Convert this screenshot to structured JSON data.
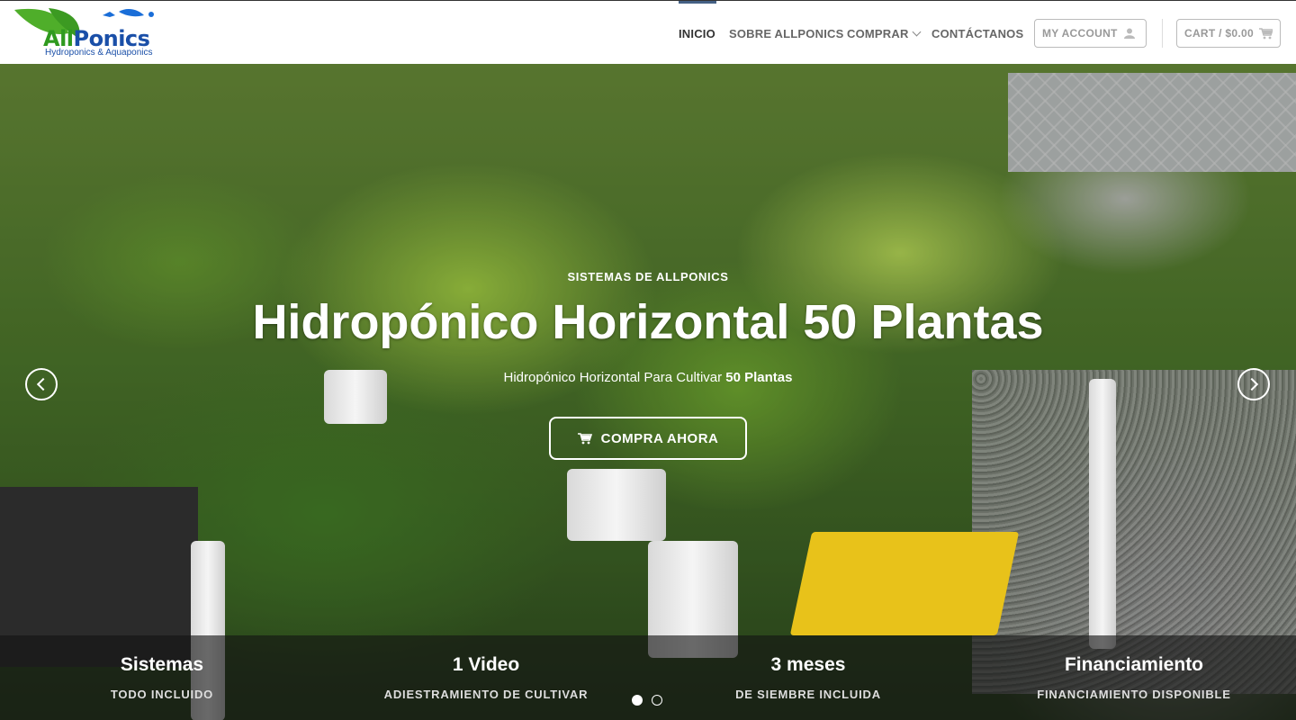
{
  "brand": {
    "logo_all": "All",
    "logo_ponics": "Ponics",
    "logo_tagline": "Hydroponics & Aquaponics",
    "green": "#2f9a1f",
    "blue": "#1a4fa8"
  },
  "nav": {
    "items": [
      {
        "label": "INICIO",
        "active": true
      },
      {
        "label": "SOBRE ALLPONICS"
      },
      {
        "label": "COMPRAR",
        "icon": "chevron-down-icon"
      },
      {
        "label": "CONTÁCTANOS"
      }
    ],
    "account_label": "MY ACCOUNT",
    "account_icon": "user-icon",
    "cart_label": "CART / $0.00",
    "cart_icon": "cart-icon",
    "accent": "#446084"
  },
  "hero": {
    "kicker": "SISTEMAS DE ALLPONICS",
    "title": "Hidropónico Horizontal 50 Plantas",
    "subtitle_prefix": "Hidropónico Horizontal Para Cultivar ",
    "subtitle_bold": "50 Plantas",
    "cta_label": "COMPRA AHORA",
    "cta_icon": "cart-icon",
    "prev_icon": "chevron-left-icon",
    "next_icon": "chevron-right-icon",
    "slide_count": 2,
    "active_slide": 1
  },
  "features": [
    {
      "title": "Sistemas",
      "subtitle": "TODO INCLUIDO"
    },
    {
      "title": "1 Video",
      "subtitle": "ADIESTRAMIENTO DE CULTIVAR"
    },
    {
      "title": "3 meses",
      "subtitle": "DE SIEMBRE INCLUIDA"
    },
    {
      "title": "Financiamiento",
      "subtitle": "FINANCIAMIENTO DISPONIBLE"
    }
  ]
}
